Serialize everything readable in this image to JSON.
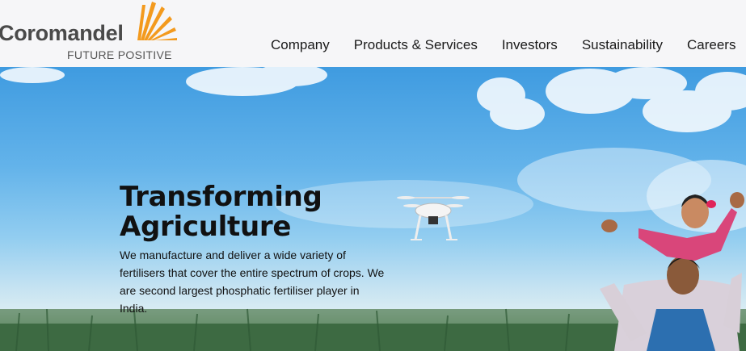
{
  "brand": {
    "name": "Coromandel",
    "tagline": "FUTURE POSITIVE"
  },
  "nav": {
    "items": [
      "Company",
      "Products & Services",
      "Investors",
      "Sustainability",
      "Careers"
    ]
  },
  "hero": {
    "title_line1": "Transforming",
    "title_line2": "Agriculture",
    "description": "We manufacture and deliver a wide variety of fertilisers that cover the entire spectrum of crops. We are second largest phosphatic fertiliser player in India."
  },
  "colors": {
    "header_bg": "#f6f6f8",
    "logo_orange": "#f39a1e",
    "sky_blue": "#4aa3e3"
  }
}
